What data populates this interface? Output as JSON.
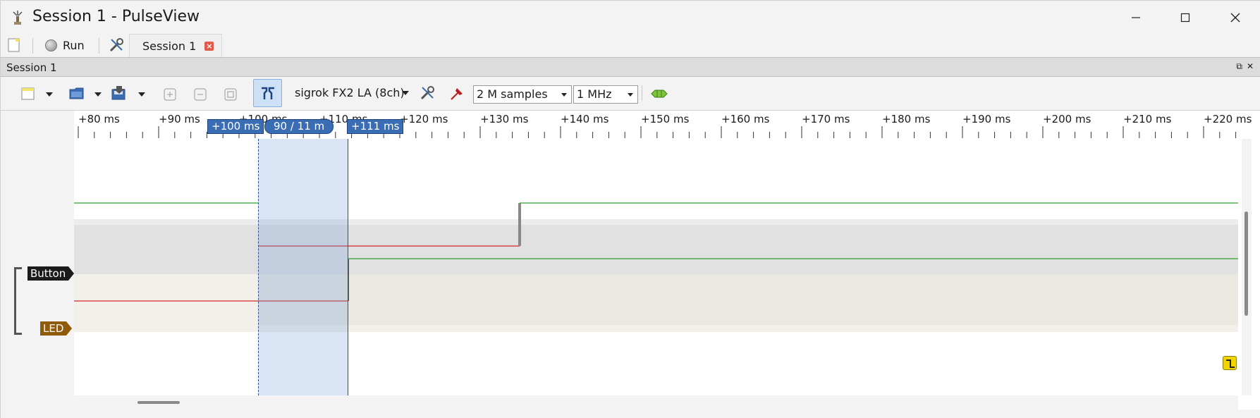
{
  "window": {
    "title": "Session 1 - PulseView"
  },
  "main_toolbar": {
    "run_label": "Run",
    "tab_label": "Session 1"
  },
  "session": {
    "header_title": "Session 1",
    "device": "sigrok FX2 LA (8ch)",
    "samples": "2 M samples",
    "samplerate": "1 MHz"
  },
  "ruler": {
    "ticks": [
      "+80 ms",
      "+90 ms",
      "+100 ms",
      "+110 ms",
      "+120 ms",
      "+130 ms",
      "+140 ms",
      "+150 ms",
      "+160 ms",
      "+170 ms",
      "+180 ms",
      "+190 ms",
      "+200 ms",
      "+210 ms",
      "+220 ms"
    ]
  },
  "cursors": {
    "left_label": "+100 ms",
    "right_label": "+111 ms",
    "span_label": "90  / 11 m"
  },
  "channels": [
    {
      "name": "Button",
      "color": "#1b1b1b"
    },
    {
      "name": "LED",
      "color": "#8f5a0a"
    }
  ],
  "colors": {
    "trace_high": "#2ea32e",
    "trace_low": "#d12a2a",
    "selection": "#78a0d7",
    "cursor_flag": "#3b6db5"
  }
}
